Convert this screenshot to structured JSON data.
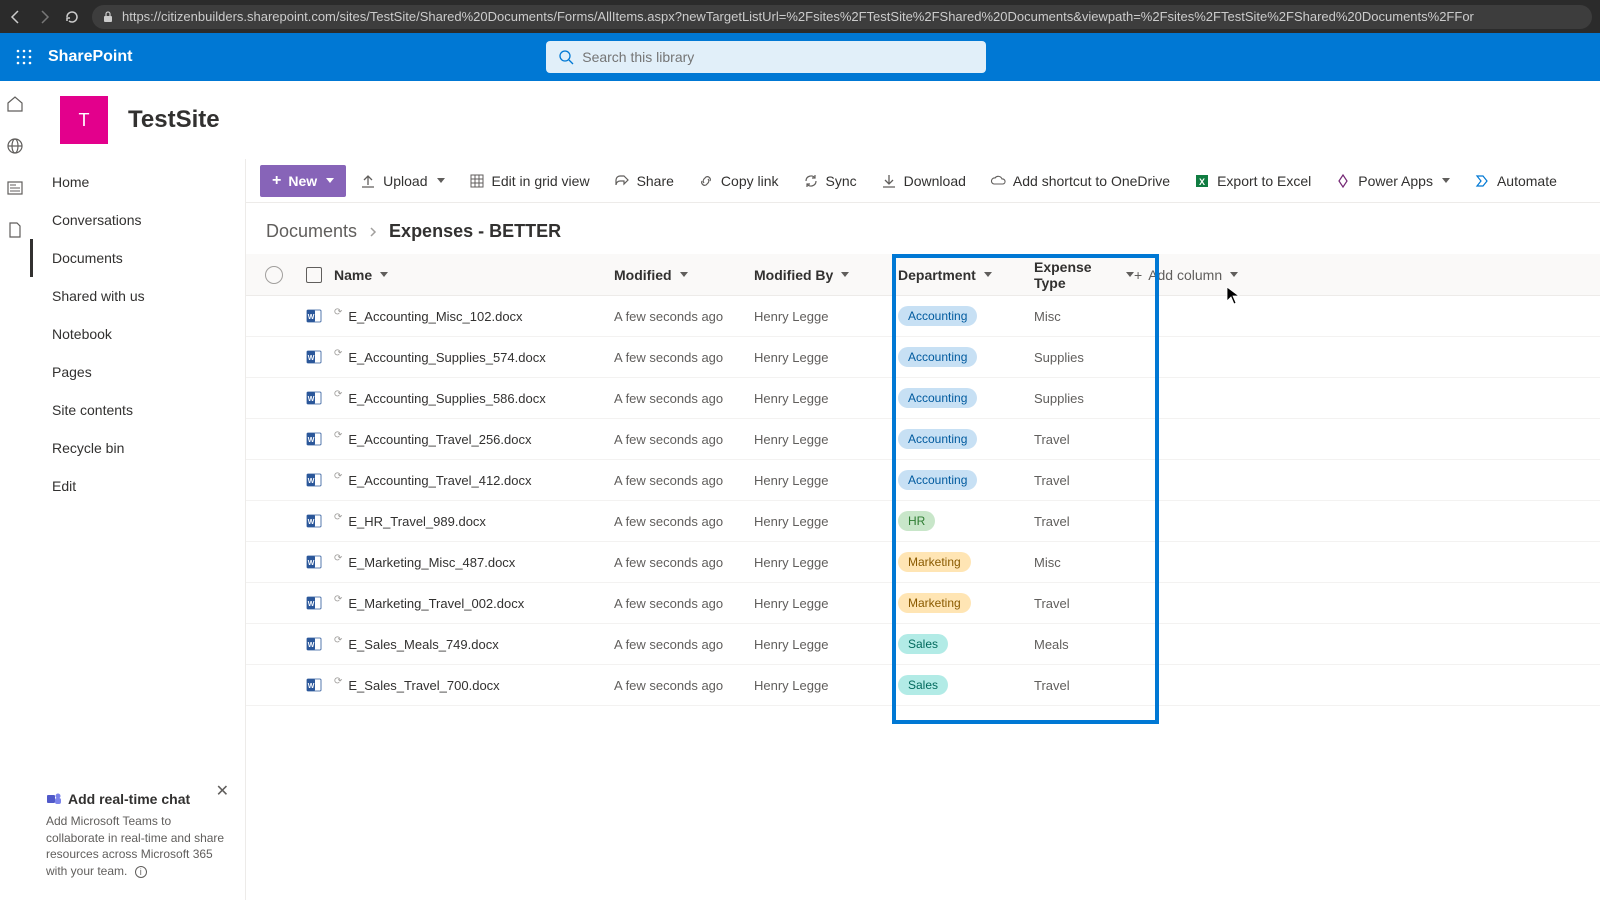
{
  "browser": {
    "url": "https://citizenbuilders.sharepoint.com/sites/TestSite/Shared%20Documents/Forms/AllItems.aspx?newTargetListUrl=%2Fsites%2FTestSite%2FShared%20Documents&viewpath=%2Fsites%2FTestSite%2FShared%20Documents%2FFor"
  },
  "suite": {
    "product": "SharePoint",
    "search_placeholder": "Search this library"
  },
  "site": {
    "logo_letter": "T",
    "name": "TestSite"
  },
  "nav": {
    "items": [
      "Home",
      "Conversations",
      "Documents",
      "Shared with us",
      "Notebook",
      "Pages",
      "Site contents",
      "Recycle bin",
      "Edit"
    ],
    "selected_index": 2
  },
  "teams_promo": {
    "title": "Add real-time chat",
    "desc": "Add Microsoft Teams to collaborate in real-time and share resources across Microsoft 365 with your team."
  },
  "cmd": {
    "new": "New",
    "upload": "Upload",
    "edit_grid": "Edit in grid view",
    "share": "Share",
    "copy_link": "Copy link",
    "sync": "Sync",
    "download": "Download",
    "onedrive": "Add shortcut to OneDrive",
    "excel": "Export to Excel",
    "power_apps": "Power Apps",
    "automate": "Automate"
  },
  "breadcrumb": {
    "root": "Documents",
    "current": "Expenses - BETTER"
  },
  "columns": {
    "name": "Name",
    "modified": "Modified",
    "modified_by": "Modified By",
    "department": "Department",
    "expense_type": "Expense Type",
    "add_column": "Add column"
  },
  "rows": [
    {
      "name": "E_Accounting_Misc_102.docx",
      "modified": "A few seconds ago",
      "modified_by": "Henry Legge",
      "department": "Accounting",
      "expense_type": "Misc"
    },
    {
      "name": "E_Accounting_Supplies_574.docx",
      "modified": "A few seconds ago",
      "modified_by": "Henry Legge",
      "department": "Accounting",
      "expense_type": "Supplies"
    },
    {
      "name": "E_Accounting_Supplies_586.docx",
      "modified": "A few seconds ago",
      "modified_by": "Henry Legge",
      "department": "Accounting",
      "expense_type": "Supplies"
    },
    {
      "name": "E_Accounting_Travel_256.docx",
      "modified": "A few seconds ago",
      "modified_by": "Henry Legge",
      "department": "Accounting",
      "expense_type": "Travel"
    },
    {
      "name": "E_Accounting_Travel_412.docx",
      "modified": "A few seconds ago",
      "modified_by": "Henry Legge",
      "department": "Accounting",
      "expense_type": "Travel"
    },
    {
      "name": "E_HR_Travel_989.docx",
      "modified": "A few seconds ago",
      "modified_by": "Henry Legge",
      "department": "HR",
      "expense_type": "Travel"
    },
    {
      "name": "E_Marketing_Misc_487.docx",
      "modified": "A few seconds ago",
      "modified_by": "Henry Legge",
      "department": "Marketing",
      "expense_type": "Misc"
    },
    {
      "name": "E_Marketing_Travel_002.docx",
      "modified": "A few seconds ago",
      "modified_by": "Henry Legge",
      "department": "Marketing",
      "expense_type": "Travel"
    },
    {
      "name": "E_Sales_Meals_749.docx",
      "modified": "A few seconds ago",
      "modified_by": "Henry Legge",
      "department": "Sales",
      "expense_type": "Meals"
    },
    {
      "name": "E_Sales_Travel_700.docx",
      "modified": "A few seconds ago",
      "modified_by": "Henry Legge",
      "department": "Sales",
      "expense_type": "Travel"
    }
  ],
  "colors": {
    "brand": "#0078d4",
    "new_btn": "#8764b8",
    "site_logo": "#e3008c"
  }
}
